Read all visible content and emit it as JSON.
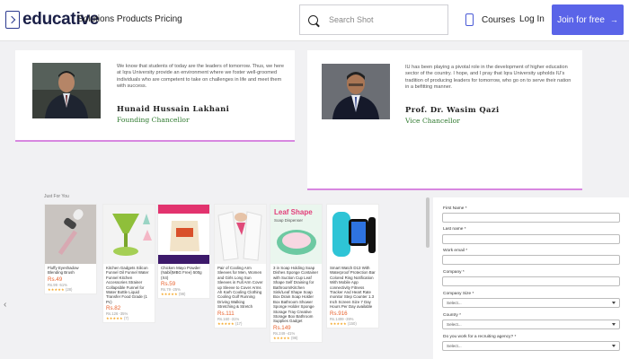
{
  "header": {
    "logo_text": "educative",
    "nav": "Solutions Products Pricing",
    "search_placeholder": "Search Shot",
    "courses": "Courses",
    "login": "Log In",
    "join": "Join for free"
  },
  "testimonials": [
    {
      "quote": "We know that students of today are the leaders of tomorrow. Thus, we here at Iqra University provide an environment where we foster well-groomed individuals who are competent to take on challenges in life and meet them with success.",
      "name": "Hunaid Hussain Lakhani",
      "role": "Founding Chancellor"
    },
    {
      "quote": "IU has been playing a pivotal role in the development of higher education sector of the country. I hope, and I pray that Iqra University upholds IU's tradition of producing leaders for tomorrow, who go on to serve their nation in a befitting manner.",
      "name": "Prof. Dr. Wasim Qazi",
      "role": "Vice Chancellor"
    }
  ],
  "products": {
    "section_title": "Just For You",
    "items": [
      {
        "desc": "Fluffy Eyeshadow Blending Brush",
        "price": "Rs.49",
        "old": "Rs.99 -51%",
        "stars": "★★★★★",
        "count": "(28)"
      },
      {
        "desc": "Kitchen Gadgets Silicon Funnel Oil Funnel Water Funnel Kitchen Accessories Strainer Collapsible Funnel for Water Bottle Liquid Transfer Food Grade (1 Pc)",
        "price": "Rs.82",
        "old": "Rs.126 -35%",
        "stars": "★★★★★",
        "count": "(7)"
      },
      {
        "desc": "Chicken Mayo Powder (Nabil)MBG Free) 500g (X4)",
        "price": "Rs.59",
        "old": "Rs.79 -25%",
        "stars": "★★★★★",
        "count": "(98)"
      },
      {
        "desc": "Pair of Cooling Arm Sleeves for Men, Women and Girls Long Sun Sleeves in Full Arm Cover up Sleeve to Cover Arms Ah Karh Cooling Clothing Cooling Golf Running Driving Walking Stretching & Stretch",
        "price": "Rs.111",
        "old": "Rs.160 -31%",
        "stars": "★★★★★",
        "count": "(17)"
      },
      {
        "desc": "3 in Soap Holding Soap Dishes Sponge Container with Suction Cup Leaf Shape Self Draining for Bathroom/Kitchen Sink/Leaf Shape Soap Box Drain Soap Holder Box Bathroom Shower Sponge Holder Sponge Storage Tray Creative Storage Box Bathroom Supplies Gadget",
        "price": "Rs.149",
        "old": "Rs.249 -41%",
        "stars": "★★★★★",
        "count": "(98)"
      },
      {
        "desc": "Smart Watch D13 With Waterproof Protection Bar Colored Ring Notification With Mobile App connectivity Fitness Tracker And Heart Rate monitor Step Counter 1.3 Inch Screen Size 7 Day Hours Per Day available",
        "price": "Rs.916",
        "old": "Rs.1499 -39%",
        "stars": "★★★★★",
        "count": "(150)"
      }
    ],
    "img_labels": {
      "leaf": "Leaf Shape",
      "leaf_sub": "Soap Dispenser"
    }
  },
  "form": {
    "fields": [
      {
        "label": "First Name *",
        "type": "input"
      },
      {
        "label": "Last name *",
        "type": "input"
      },
      {
        "label": "Work email *",
        "type": "input"
      },
      {
        "label": "Company *",
        "type": "input"
      },
      {
        "label": "Company Size *",
        "type": "select",
        "value": "Select..."
      },
      {
        "label": "Country *",
        "type": "select",
        "value": "Select..."
      },
      {
        "label": "Do you work for a recruiting agency? *",
        "type": "select",
        "value": "Select..."
      }
    ]
  },
  "colors": {
    "accent": "#5a64e8",
    "card_border": "#d887e0",
    "role": "#2f7a2f",
    "price": "#e8612c"
  }
}
